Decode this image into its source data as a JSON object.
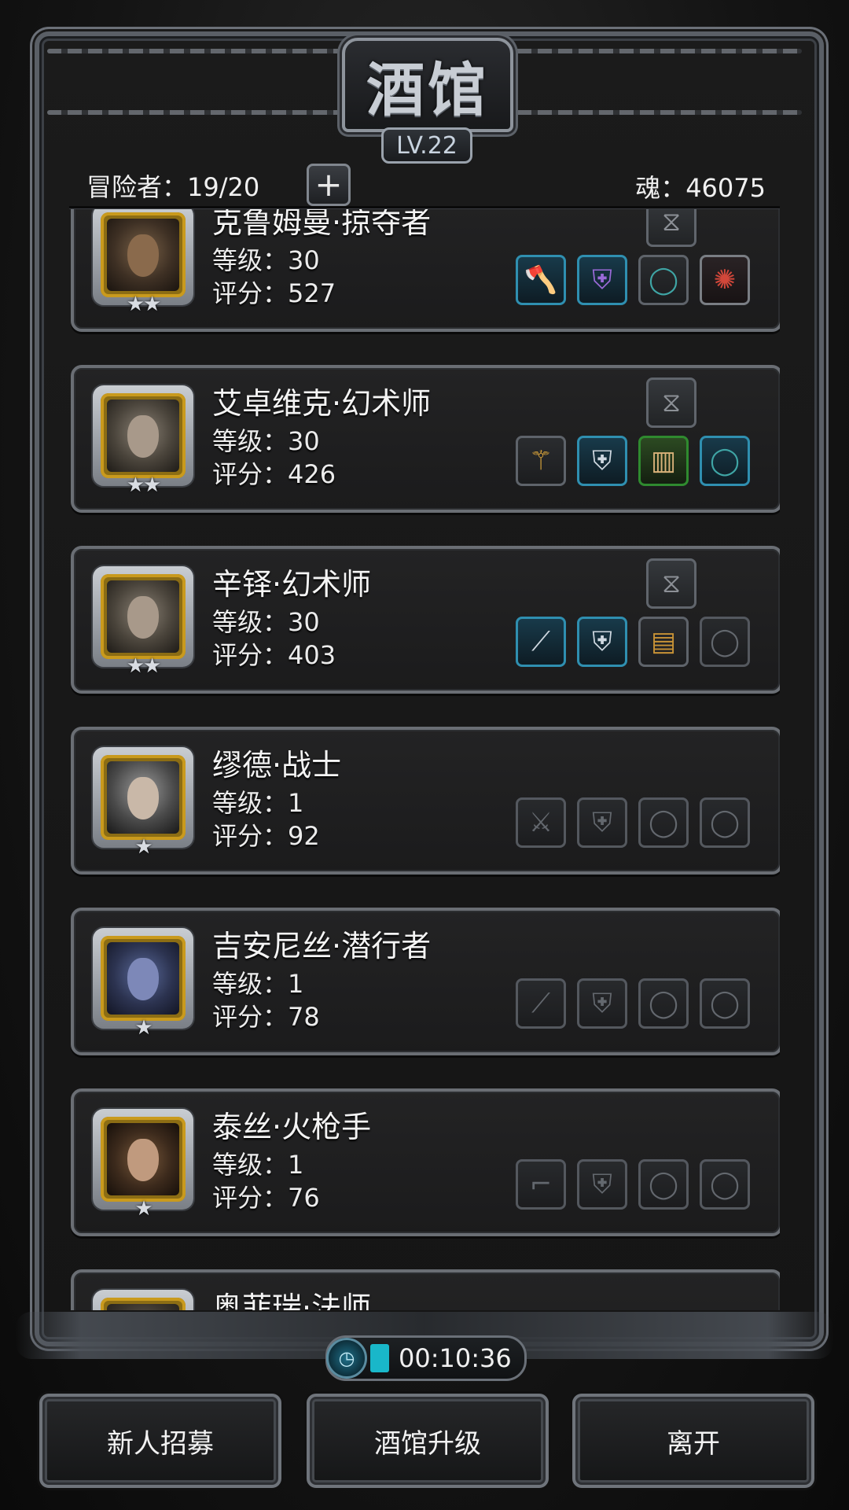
{
  "title": "酒馆",
  "level_badge": "LV.22",
  "header": {
    "adventurers_label": "冒险者：19/20",
    "plus": "+",
    "soul_label": "魂：46075"
  },
  "heroes": [
    {
      "name": "克鲁姆曼·掠夺者",
      "level": "等级：30",
      "score": "评分：527",
      "stars": "★★",
      "equip": [
        "axe-icon",
        "purple-armor-icon",
        "ring-icon",
        "amulet-icon"
      ]
    },
    {
      "name": "艾卓维克·幻术师",
      "level": "等级：30",
      "score": "评分：426",
      "stars": "★★",
      "equip": [
        "staff-icon",
        "armor-icon",
        "wood-shield-icon",
        "ring-icon"
      ]
    },
    {
      "name": "辛铎·幻术师",
      "level": "等级：30",
      "score": "评分：403",
      "stars": "★★",
      "equip": [
        "wand-icon",
        "armor-icon",
        "chest-shield-icon",
        "ring-empty-icon"
      ]
    },
    {
      "name": "缪德·战士",
      "level": "等级：1",
      "score": "评分：92",
      "stars": "★",
      "equip": [
        "sword-empty-icon",
        "armor-empty-icon",
        "ring-empty-icon",
        "ring-empty-icon"
      ]
    },
    {
      "name": "吉安尼丝·潜行者",
      "level": "等级：1",
      "score": "评分：78",
      "stars": "★",
      "equip": [
        "dagger-empty-icon",
        "armor-empty-icon",
        "ring-empty-icon",
        "ring-empty-icon"
      ]
    },
    {
      "name": "泰丝·火枪手",
      "level": "等级：1",
      "score": "评分：76",
      "stars": "★",
      "equip": [
        "gun-empty-icon",
        "armor-empty-icon",
        "ring-empty-icon",
        "ring-empty-icon"
      ]
    },
    {
      "name": "奥菲瑞·法师",
      "level": "",
      "score": "",
      "stars": "",
      "equip": []
    }
  ],
  "timer": "00:10:36",
  "buttons": {
    "recruit": "新人招募",
    "upgrade": "酒馆升级",
    "leave": "离开"
  },
  "colors": {
    "rare_slot": "#2f8fb0",
    "uncommon_slot": "#2f8a2f",
    "avatar_gold": "#c99a1d"
  }
}
